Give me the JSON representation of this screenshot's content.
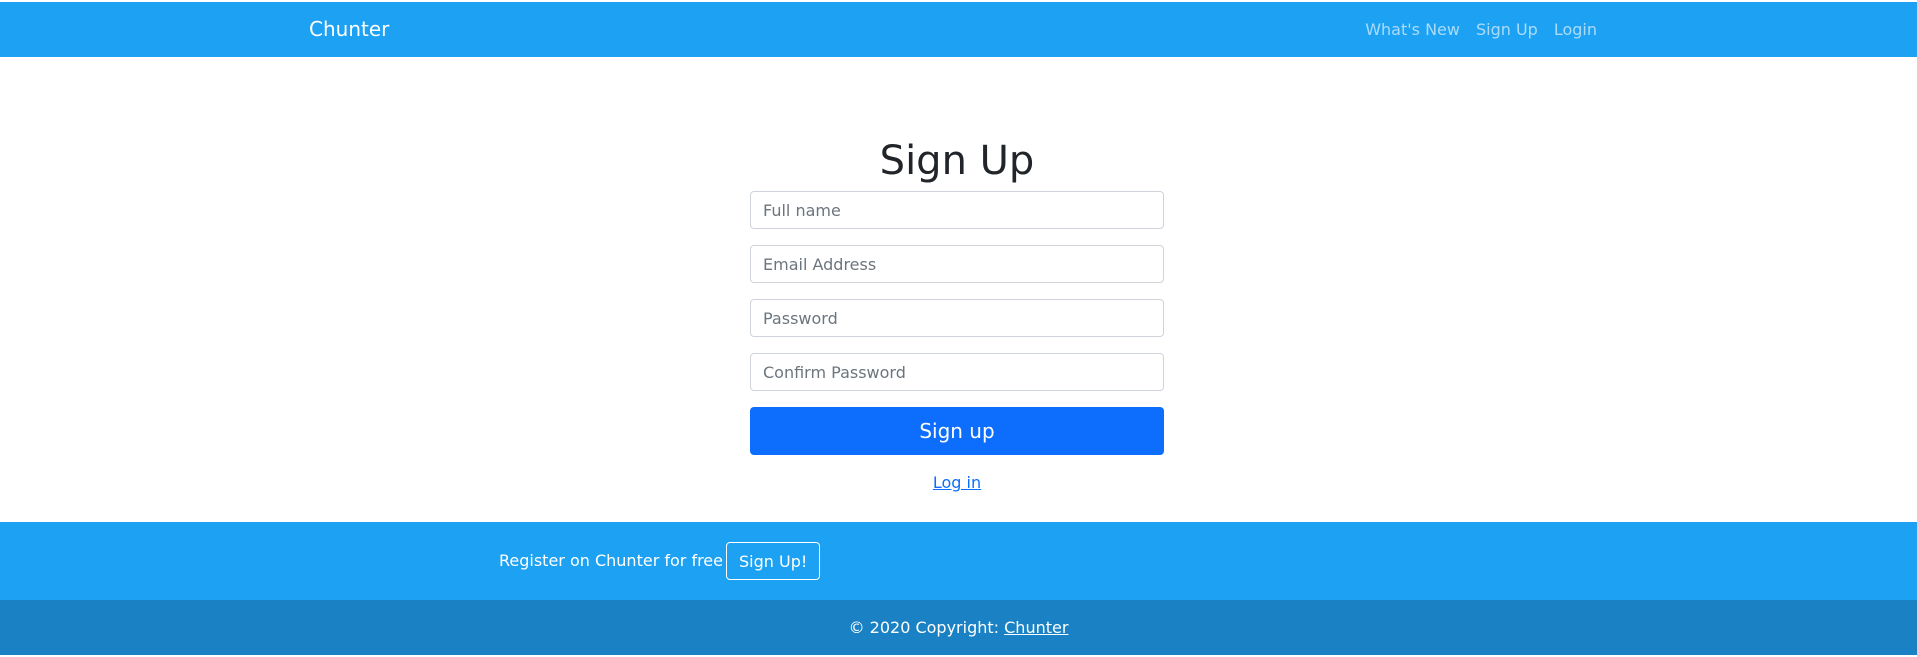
{
  "navbar": {
    "brand": "Chunter",
    "links": [
      {
        "label": "What's New"
      },
      {
        "label": "Sign Up"
      },
      {
        "label": "Login"
      }
    ]
  },
  "form": {
    "title": "Sign Up",
    "fields": [
      {
        "placeholder": "Full name",
        "value": ""
      },
      {
        "placeholder": "Email Address",
        "value": ""
      },
      {
        "placeholder": "Password",
        "value": ""
      },
      {
        "placeholder": "Confirm Password",
        "value": ""
      }
    ],
    "submit_label": "Sign up",
    "login_link": "Log in"
  },
  "cta": {
    "text": "Register on Chunter for free",
    "button_label": "Sign Up!"
  },
  "footer": {
    "copyright": "© 2020 Copyright: ",
    "link": "Chunter"
  },
  "colors": {
    "navbar_bg": "#1da1f2",
    "primary_button": "#0d6efd",
    "footer_bg": "#1a82c4"
  }
}
